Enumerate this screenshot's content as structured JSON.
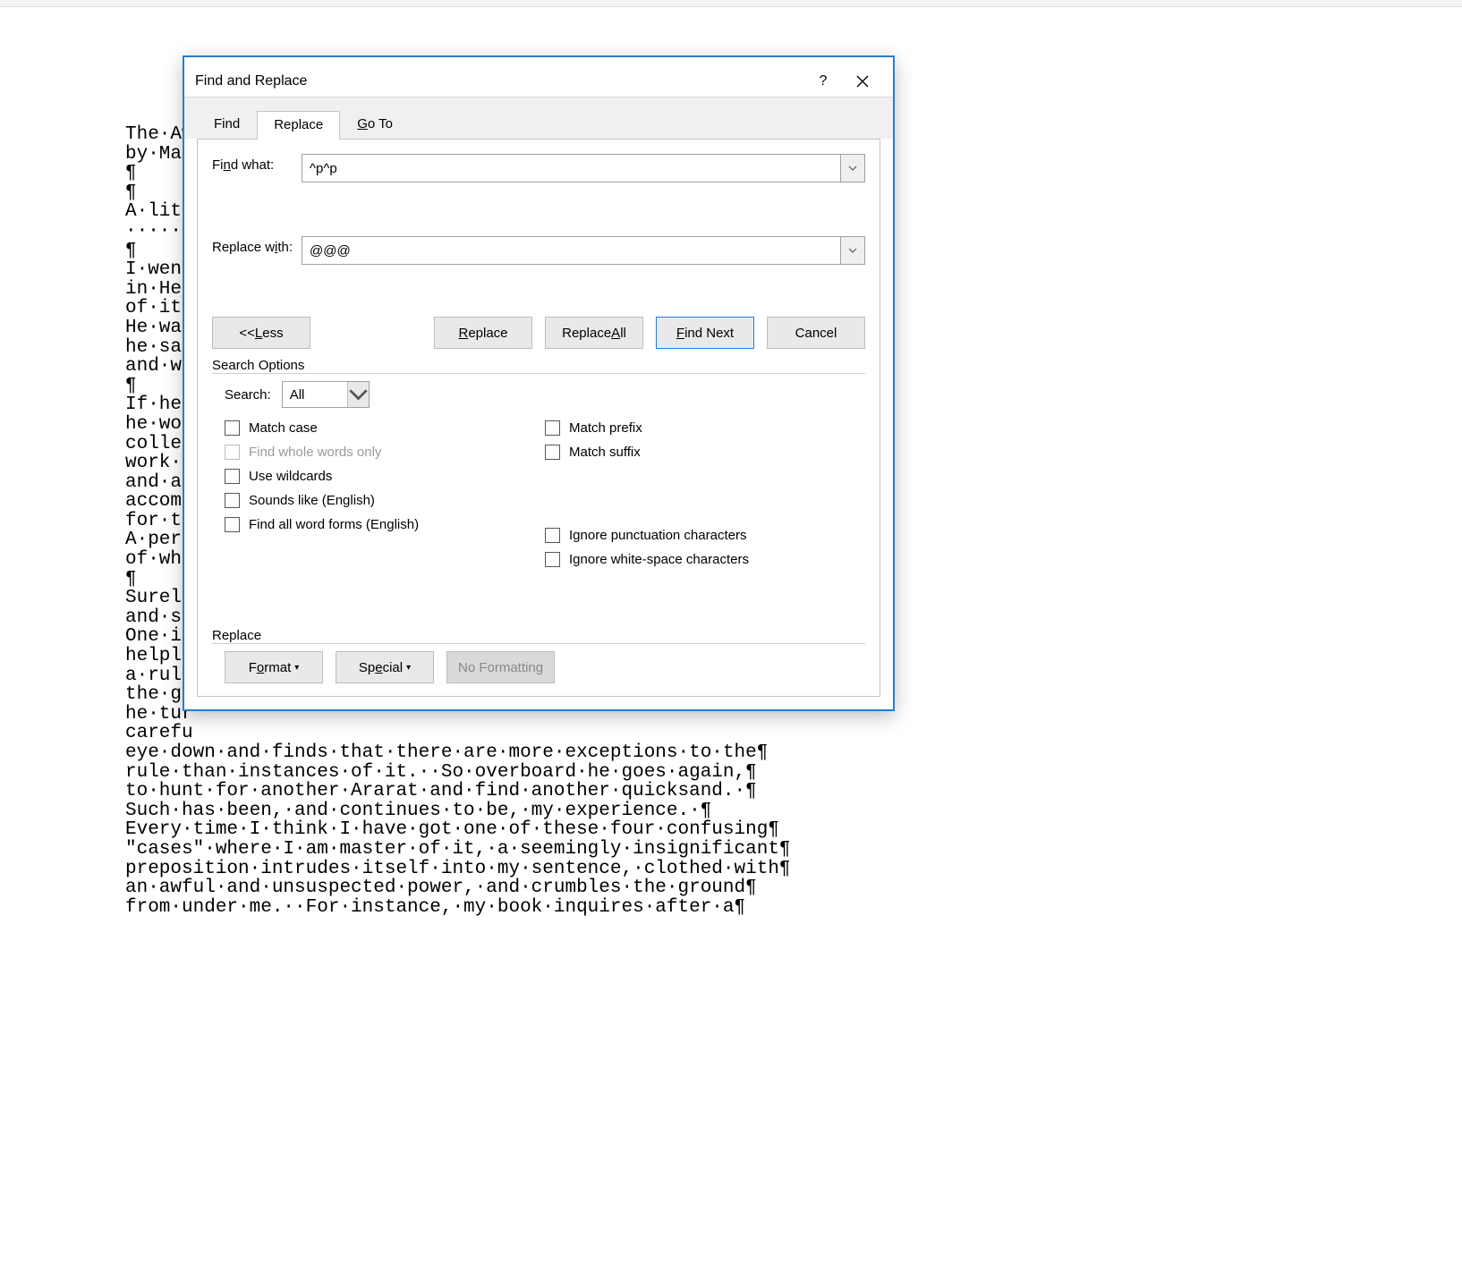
{
  "doc_text": "The·Aw\nby·Mar\n¶\n¶\nA·litt\n·····\n¶\nI·went\nin·Hei\nof·it\nHe·was\nhe·sai\nand·wa\n¶\nIf·he\nhe·wou\ncollec\nwork·o\nand·al\naccomp\nfor·th\nA·pers\nof·wha\n¶\nSurely\nand·sy\nOne·is\nhelple\na·rule\nthe·ge\nhe·tur\ncarefu\neye·down·and·finds·that·there·are·more·exceptions·to·the¶\nrule·than·instances·of·it.··So·overboard·he·goes·again,¶\nto·hunt·for·another·Ararat·and·find·another·quicksand.·¶\nSuch·has·been,·and·continues·to·be,·my·experience.·¶\nEvery·time·I·think·I·have·got·one·of·these·four·confusing¶\n\"cases\"·where·I·am·master·of·it,·a·seemingly·insignificant¶\npreposition·intrudes·itself·into·my·sentence,·clothed·with¶\nan·awful·and·unsuspected·power,·and·crumbles·the·ground¶\nfrom·under·me.··For·instance,·my·book·inquires·after·a¶",
  "dialog": {
    "title": "Find and Replace",
    "help_label": "?",
    "tabs": {
      "find": "Find",
      "replace": "Replace",
      "goto_pre": "G",
      "goto_rest": "o To"
    },
    "find_label_pre": "Fi",
    "find_label_ul": "n",
    "find_label_post": "d what:",
    "find_value": "^p^p",
    "replace_label_pre": "Replace w",
    "replace_label_ul": "i",
    "replace_label_post": "th:",
    "replace_value": "@@@",
    "buttons": {
      "less_pre": "<< ",
      "less_ul": "L",
      "less_post": "ess",
      "replace_ul": "R",
      "replace_post": "eplace",
      "replace_all_pre": "Replace ",
      "replace_all_ul": "A",
      "replace_all_post": "ll",
      "find_next_ul": "F",
      "find_next_post": "ind Next",
      "cancel": "Cancel"
    },
    "group_search_options": "Search Options",
    "search_label_pre": "Search",
    "search_label_ul": ":",
    "search_value": "All",
    "checks": {
      "match_case_pre": "Matc",
      "match_case_ul": "h",
      "match_case_post": " case",
      "whole_words": "Find whole words only",
      "wildcards_ul": "U",
      "wildcards_post": "se wildcards",
      "sounds_like": "Sounds like (English)",
      "word_forms_pre": "Find all ",
      "word_forms_ul": "w",
      "word_forms_post": "ord forms (English)",
      "match_prefix_pre": "Match prefi",
      "match_prefix_ul": "x",
      "match_suffix_pre": "Ma",
      "match_suffix_ul": "t",
      "match_suffix_post": "ch suffix",
      "ignore_punct_pre": "Ignore punctuation character",
      "ignore_punct_ul": "s",
      "ignore_ws_pre": "Ignore ",
      "ignore_ws_ul": "w",
      "ignore_ws_post": "hite-space characters"
    },
    "group_replace": "Replace",
    "format_pre": "F",
    "format_ul": "o",
    "format_post": "rmat",
    "special_pre": "Sp",
    "special_ul": "e",
    "special_post": "cial",
    "no_formatting": "No Formatting"
  }
}
